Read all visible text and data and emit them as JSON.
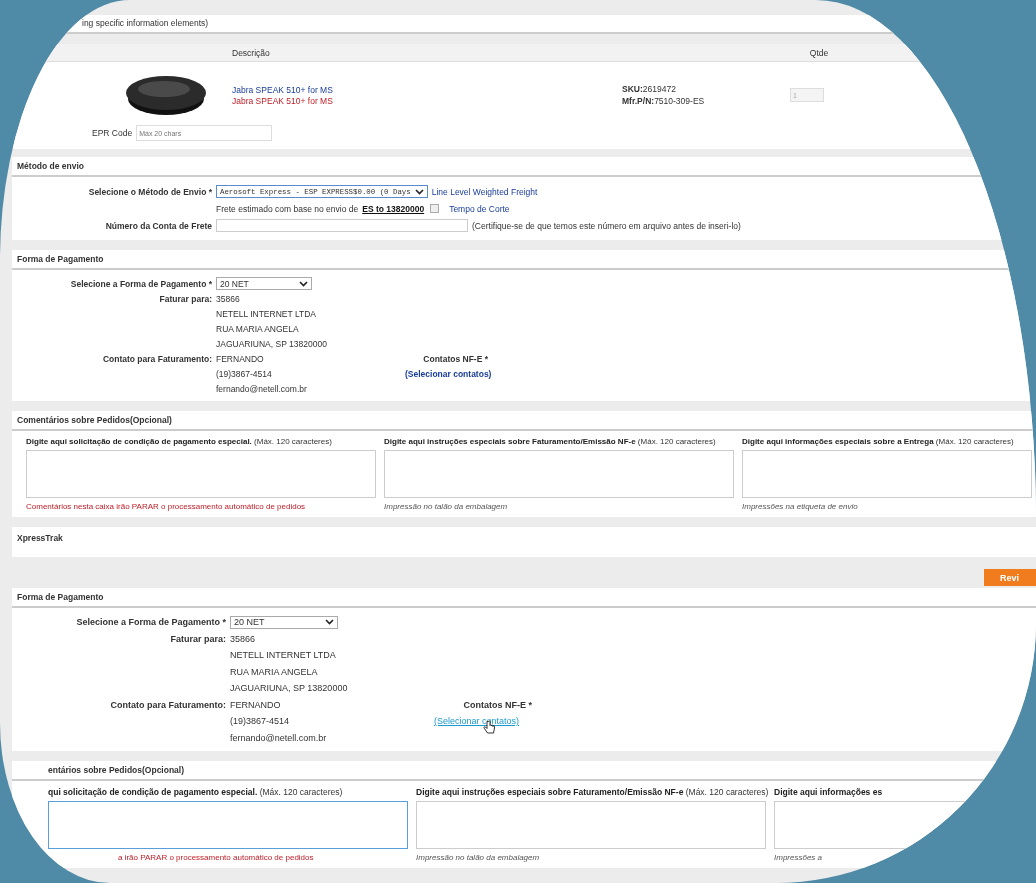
{
  "intro": {
    "text": "ing specific information elements)"
  },
  "products": {
    "columns": [
      {
        "kind": "description",
        "label": "Descrição"
      },
      {
        "kind": "quantity",
        "label": "Qtde"
      }
    ],
    "rows": [
      {
        "title": "Jabra SPEAK 510+ for MS",
        "subtitle": "Jabra SPEAK 510+ for MS",
        "sku_label": "SKU:",
        "sku": "2619472",
        "mfr_label": "Mfr.P/N:",
        "mfr": "7510-309-ES",
        "quantity": "1"
      }
    ],
    "epr": {
      "label": "EPR Code",
      "placeholder": "Máx 20 chars"
    }
  },
  "shipping": {
    "title": "Método de envio",
    "method_label": "Selecione o Método de Envio *",
    "method_value": "Aerosoft Express - ESP EXPRESS$0.00 (0 Days",
    "method_link": "Line Level Weighted Freight",
    "estimate_text": "Frete estimado com base no envio de",
    "estimate_link": "ES to 13820000",
    "estimate_checked": false,
    "cutoff_link": "Tempo de Corte",
    "account_label": "Número da Conta de Frete",
    "account_note": "(Certifique-se de que temos este número em arquivo antes de inseri-lo)"
  },
  "sections": [
    {
      "kind": "payment",
      "title": "Forma de Pagamento",
      "method_label": "Selecione a Forma de Pagamento *",
      "method_value": "20 NET",
      "bill_label": "Faturar para:",
      "bill_lines": [
        "35866",
        "NETELL INTERNET LTDA",
        "RUA MARIA ANGELA",
        "JAGUARIUNA, SP 13820000"
      ],
      "contact_label": "Contato para Faturamento:",
      "contact_lines": [
        "FERNANDO",
        "(19)3867-4514",
        "fernando@netell.com.br"
      ],
      "nfe_label": "Contatos NF-E *",
      "nfe_link": "(Selecionar contatos)",
      "link_hover": false
    },
    {
      "kind": "comments",
      "title": "Comentários sobre Pedidos(Opcional)",
      "columns": [
        {
          "kind": "warning",
          "label": "**Digite aqui solicitação de condição de pagamento especial.** (Máx. 120 caracteres)",
          "focused": false,
          "note": "Comentários nesta caixa irão PARAR o processamento automático de pedidos"
        },
        {
          "kind": "hint",
          "label": "**Digite aqui instruções especiais sobre Faturamento/Emissão NF-e** (Máx. 120 caracteres)",
          "focused": false,
          "note": "Impressão no talão da embalagem"
        },
        {
          "kind": "hint",
          "label": "**Digite aqui informações especiais sobre a Entrega** (Máx. 120 caracteres)",
          "focused": false,
          "note": "Impressões na etiqueta de envio"
        }
      ]
    },
    {
      "kind": "panel",
      "title": "XpressTrak"
    },
    {
      "kind": "button",
      "label": "Revi"
    },
    {
      "kind": "payment",
      "title": "Forma de Pagamento",
      "method_label": "Selecione a Forma de Pagamento *",
      "method_value": "20 NET",
      "bill_label": "Faturar para:",
      "bill_lines": [
        "35866",
        "NETELL INTERNET LTDA",
        "RUA MARIA ANGELA",
        "JAGUARIUNA, SP 13820000"
      ],
      "contact_label": "Contato para Faturamento:",
      "contact_lines": [
        "FERNANDO",
        "(19)3867-4514",
        "fernando@netell.com.br"
      ],
      "nfe_label": "Contatos NF-E *",
      "nfe_link": "(Selecionar contatos)",
      "link_hover": true
    },
    {
      "kind": "comments",
      "title": "entários sobre Pedidos(Opcional)",
      "columns": [
        {
          "kind": "warning",
          "label": "**qui solicitação de condição de pagamento especial.** (Máx. 120 caracteres)",
          "focused": true,
          "note": "a irão PARAR o processamento automático de pedidos"
        },
        {
          "kind": "hint",
          "label": "**Digite aqui instruções especiais sobre Faturamento/Emissão NF-e** (Máx. 120 caracteres)",
          "focused": false,
          "note": "Impressão no talão da embalagem"
        },
        {
          "kind": "hint",
          "label": "**Digite aqui informações es**",
          "focused": false,
          "note": "Impressões a"
        }
      ]
    }
  ]
}
